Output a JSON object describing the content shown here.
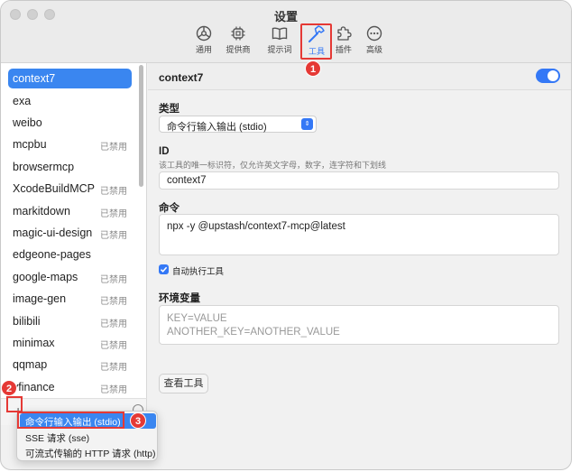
{
  "window": {
    "title": "设置"
  },
  "toolbar": {
    "items": [
      {
        "label": "通用",
        "icon": "general-icon"
      },
      {
        "label": "提供商",
        "icon": "chip-icon"
      },
      {
        "label": "提示词",
        "icon": "book-icon"
      },
      {
        "label": "工具",
        "icon": "hammer-icon",
        "active": true
      },
      {
        "label": "插件",
        "icon": "puzzle-icon"
      },
      {
        "label": "高级",
        "icon": "more-icon"
      }
    ]
  },
  "sidebar": {
    "items": [
      {
        "name": "context7",
        "status": "",
        "selected": true
      },
      {
        "name": "exa",
        "status": ""
      },
      {
        "name": "weibo",
        "status": ""
      },
      {
        "name": "mcpbu",
        "status": "已禁用"
      },
      {
        "name": "browsermcp",
        "status": ""
      },
      {
        "name": "XcodeBuildMCP",
        "status": "已禁用"
      },
      {
        "name": "markitdown",
        "status": "已禁用"
      },
      {
        "name": "magic-ui-design",
        "status": "已禁用"
      },
      {
        "name": "edgeone-pages",
        "status": ""
      },
      {
        "name": "google-maps",
        "status": "已禁用"
      },
      {
        "name": "image-gen",
        "status": "已禁用"
      },
      {
        "name": "bilibili",
        "status": "已禁用"
      },
      {
        "name": "minimax",
        "status": "已禁用"
      },
      {
        "name": "qqmap",
        "status": "已禁用"
      },
      {
        "name": "yfinance",
        "status": "已禁用"
      }
    ],
    "add_symbol": "+"
  },
  "detail": {
    "title": "context7",
    "enabled": true,
    "type_label": "类型",
    "type_value": "命令行输入输出 (stdio)",
    "id_label": "ID",
    "id_help": "该工具的唯一标识符，仅允许英文字母，数字，连字符和下划线",
    "id_value": "context7",
    "command_label": "命令",
    "command_value": "npx -y @upstash/context7-mcp@latest",
    "auto_run_label": "自动执行工具",
    "auto_run_checked": true,
    "env_label": "环境变量",
    "env_placeholder_line1": "KEY=VALUE",
    "env_placeholder_line2": "ANOTHER_KEY=ANOTHER_VALUE",
    "view_tools_button": "查看工具"
  },
  "popup_menu": {
    "items": [
      {
        "label": "命令行输入输出 (stdio)",
        "highlighted": true
      },
      {
        "label": "SSE 请求 (sse)"
      },
      {
        "label": "可流式传输的 HTTP 请求 (http)"
      }
    ]
  },
  "annotations": {
    "step1": "1",
    "step2": "2",
    "step3": "3"
  },
  "colors": {
    "accent": "#3478f6",
    "annotation_red": "#e53935",
    "selection_blue": "#3a86f0"
  }
}
